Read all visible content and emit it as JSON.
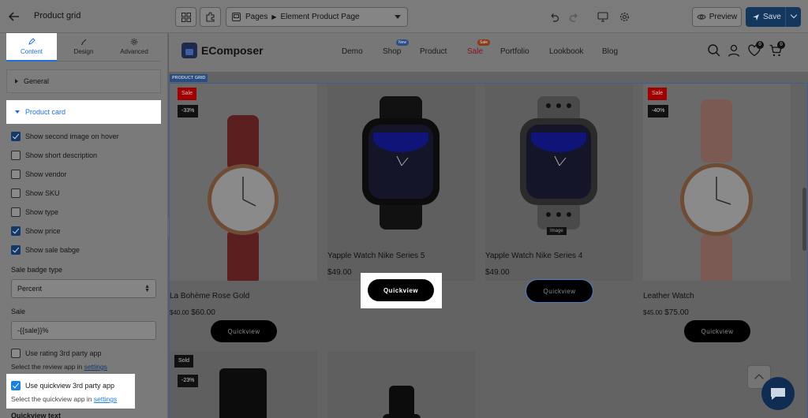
{
  "topbar": {
    "panel_title": "Product grid",
    "pages_label": "Pages",
    "page_name": "Element Product Page",
    "preview_label": "Preview",
    "save_label": "Save"
  },
  "sidebar": {
    "tabs": [
      {
        "label": "Content",
        "icon": "pencil-icon",
        "active": true
      },
      {
        "label": "Design",
        "icon": "brush-icon",
        "active": false
      },
      {
        "label": "Advanced",
        "icon": "gear-icon",
        "active": false
      }
    ],
    "sections": {
      "general": "General",
      "product_card": "Product card"
    },
    "options": [
      {
        "label": "Show second image on hover",
        "checked": true
      },
      {
        "label": "Show short description",
        "checked": false
      },
      {
        "label": "Show vendor",
        "checked": false
      },
      {
        "label": "Show SKU",
        "checked": false
      },
      {
        "label": "Show type",
        "checked": false
      },
      {
        "label": "Show price",
        "checked": true
      },
      {
        "label": "Show sale babge",
        "checked": true
      }
    ],
    "badge_type_label": "Sale badge type",
    "badge_type_value": "Percent",
    "sale_label": "Sale",
    "sale_value": "-{{sale}}%",
    "rating_label": "Use rating 3rd party app",
    "rating_hint": "Select the review app in",
    "rating_link": "settings",
    "quickview_label": "Use quickview 3rd party app",
    "quickview_hint": "Select the quickview app in",
    "quickview_link": "settings",
    "quickview_text_label": "Quickview text"
  },
  "store": {
    "logo": "EComposer",
    "menu": [
      {
        "label": "Demo",
        "badge": ""
      },
      {
        "label": "Shop",
        "badge": "New"
      },
      {
        "label": "Product",
        "badge": ""
      },
      {
        "label": "Sale",
        "badge": "Sale"
      },
      {
        "label": "Portfolio",
        "badge": ""
      },
      {
        "label": "Lookbook",
        "badge": ""
      },
      {
        "label": "Blog",
        "badge": ""
      }
    ],
    "wishlist_count": "0",
    "cart_count": "0",
    "grid_tag": "PRODUCT GRID",
    "quickview_label": "Quickview",
    "image_tooltip": "Image",
    "products": [
      {
        "title": "La Bohème Rose Gold",
        "compare_price": "$40.00",
        "price": "$60.00",
        "sale_badge": "Sale",
        "pct_badge": "-33%"
      },
      {
        "title": "Yapple Watch Nike Series 5",
        "compare_price": "",
        "price": "$49.00",
        "sale_badge": "",
        "pct_badge": ""
      },
      {
        "title": "Yapple Watch Nike Series 4",
        "compare_price": "",
        "price": "$49.00",
        "sale_badge": "",
        "pct_badge": ""
      },
      {
        "title": "Leather Watch",
        "compare_price": "$45.00",
        "price": "$75.00",
        "sale_badge": "Sale",
        "pct_badge": "-40%"
      }
    ],
    "row2_badges": {
      "sold": "Sold",
      "pct": "-23%"
    }
  }
}
